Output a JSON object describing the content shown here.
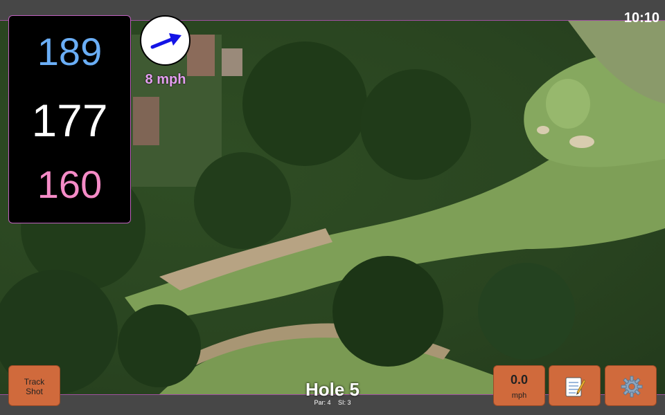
{
  "status": {
    "time": "10:10"
  },
  "distances": {
    "back": "189",
    "middle": "177",
    "front": "160"
  },
  "wind": {
    "speed": "8 mph",
    "arrow_icon": "wind-arrow-icon"
  },
  "hole": {
    "title": "Hole 5",
    "par": "Par: 4",
    "stroke_index": "SI: 3"
  },
  "buttons": {
    "track_shot_line1": "Track",
    "track_shot_line2": "Shot",
    "speed_value": "0.0",
    "speed_unit": "mph",
    "notes_icon": "notepad-icon",
    "settings_icon": "gear-icon"
  },
  "colors": {
    "back_distance": "#6aaef6",
    "middle_distance": "#ffffff",
    "front_distance": "#f58bc7",
    "button": "#d06a3c",
    "accent": "#a050a0"
  }
}
